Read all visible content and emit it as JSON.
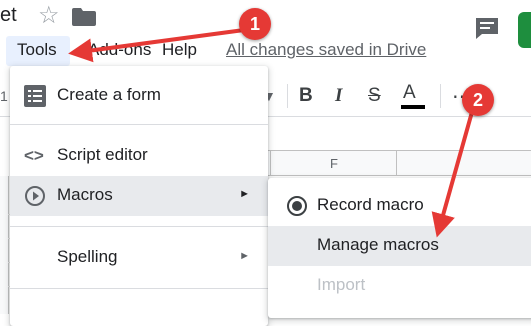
{
  "doc": {
    "title_fragment": "et"
  },
  "menubar": {
    "tools": "Tools",
    "addons": "Add-ons",
    "help": "Help",
    "saved_status": "All changes saved in Drive"
  },
  "toolbar": {
    "edge_label": "1",
    "bold": "B",
    "italic": "I",
    "strike": "S",
    "text_color": "A",
    "text_color_bar": "#000000"
  },
  "grid": {
    "column_f": "F"
  },
  "tools_menu": {
    "items": [
      {
        "label": "Create a form",
        "icon": "form-list-icon"
      },
      {
        "label": "Script editor",
        "icon": "code-brackets-icon"
      },
      {
        "label": "Macros",
        "icon": "play-circle-icon",
        "submenu": "►"
      },
      {
        "label": "Spelling",
        "submenu": "►"
      }
    ]
  },
  "macros_menu": {
    "items": [
      {
        "label": "Record macro",
        "icon": "record-icon"
      },
      {
        "label": "Manage macros"
      },
      {
        "label": "Import",
        "disabled": true
      }
    ]
  },
  "annotations": {
    "step1": "1",
    "step2": "2",
    "color": "#e53935"
  }
}
